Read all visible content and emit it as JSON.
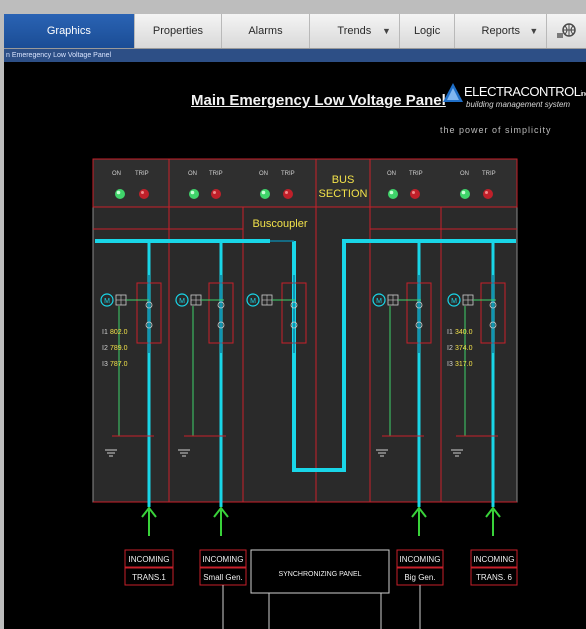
{
  "menu": {
    "items": [
      {
        "label": "Graphics",
        "active": true,
        "dropdown": false
      },
      {
        "label": "Properties",
        "active": false,
        "dropdown": false
      },
      {
        "label": "Alarms",
        "active": false,
        "dropdown": false
      },
      {
        "label": "Trends",
        "active": false,
        "dropdown": true
      },
      {
        "label": "Logic",
        "active": false,
        "dropdown": false
      },
      {
        "label": "Reports",
        "active": false,
        "dropdown": true
      }
    ],
    "icon": "network-icon"
  },
  "breadcrumb": "n Emeregency Low Voltage Panel",
  "panel": {
    "title": "Main Emergency Low Voltage Panel",
    "logo": {
      "brand": "ELECTRACONTROL",
      "suffix": "inc",
      "sub": "building management system",
      "tagline": "the power of simplicity"
    },
    "on_label": "ON",
    "trip_label": "TRIP",
    "bus_section": [
      "BUS",
      "SECTION"
    ],
    "buscoupler": "Buscoupler",
    "readings_left": [
      "802.0",
      "789.0",
      "787.0"
    ],
    "readings_right": [
      "340.0",
      "374.0",
      "317.0"
    ],
    "incoming": [
      {
        "line1": "INCOMING",
        "line2": "TRANS.1"
      },
      {
        "line1": "INCOMING",
        "line2": "Small Gen."
      },
      {
        "line1": "INCOMING",
        "line2": "Big Gen."
      },
      {
        "line1": "INCOMING",
        "line2": "TRANS. 6"
      }
    ],
    "sync_panel": "SYNCHRONIZING PANEL",
    "colors": {
      "bus": "#19d6e8",
      "frame": "#c8202a",
      "on_lamp": "#3fd36a",
      "trip_lamp": "#c0202a",
      "arrow": "#39d23a",
      "label": "#f2e24a"
    }
  }
}
